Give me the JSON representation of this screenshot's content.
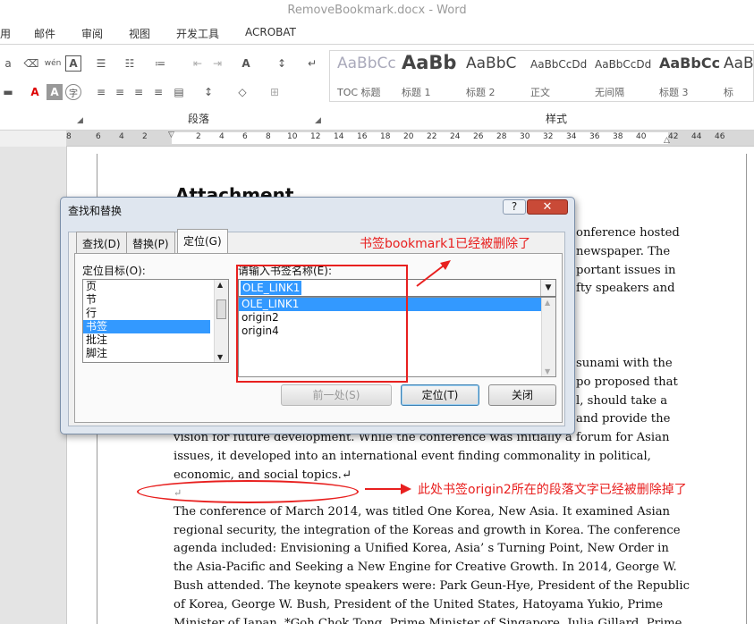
{
  "window": {
    "title": "RemoveBookmark.docx - Word"
  },
  "menu": {
    "items": [
      "用",
      "邮件",
      "审阅",
      "视图",
      "开发工具",
      "ACROBAT"
    ]
  },
  "ribbon": {
    "styles": [
      {
        "sample": "AaBbCc",
        "name": "TOC 标题"
      },
      {
        "sample": "AaBb",
        "name": "标题 1"
      },
      {
        "sample": "AaBbC",
        "name": "标题 2"
      },
      {
        "sample": "AaBbCcDd",
        "name": "正文"
      },
      {
        "sample": "AaBbCcDd",
        "name": "无间隔"
      },
      {
        "sample": "AaBbCc",
        "name": "标题 3"
      },
      {
        "sample": "AaBl",
        "name": "标"
      }
    ],
    "group_paragraph": "段落",
    "group_styles": "样式"
  },
  "ruler": {
    "numbers": [
      "8",
      "6",
      "4",
      "2",
      "2",
      "4",
      "6",
      "8",
      "10",
      "12",
      "14",
      "16",
      "18",
      "20",
      "22",
      "24",
      "26",
      "28",
      "30",
      "32",
      "34",
      "36",
      "38",
      "40",
      "42",
      "44",
      "46"
    ]
  },
  "document": {
    "heading": "Attachment",
    "right_fragments": [
      "onference hosted",
      "newspaper. The",
      "portant issues in",
      "fty speakers and"
    ],
    "right_fragments2": [
      "sunami with the",
      "po proposed that",
      "l, should take a",
      "and provide the"
    ],
    "lines_a": [
      "vision for future development. While the conference was initially a forum for Asian",
      "issues, it developed into an international event finding commonality in political,",
      "economic, and social topics.↵"
    ],
    "empty_para": "↵",
    "lines_b": [
      "The conference of March 2014, was titled One Korea, New Asia. It examined Asian",
      "regional security, the integration of the Koreas and growth in Korea. The conference",
      "agenda included: Envisioning a Unified Korea, Asia’ s Turning Point, New Order in",
      "the Asia-Pacific and Seeking a New Engine for Creative Growth. In 2014, George W.",
      "Bush attended. The keynote speakers were: Park Geun-Hye, President of the Republic",
      "of Korea, George W. Bush, President of the United States, Hatoyama Yukio, Prime",
      "Minister of Japan, *Goh Chok Tong, Prime Minister of Singapore, Julia Gillard, Prime"
    ]
  },
  "dialog": {
    "title": "查找和替换",
    "help": "?",
    "close": "✕",
    "tabs": [
      "查找(D)",
      "替换(P)",
      "定位(G)"
    ],
    "target_label": "定位目标(O):",
    "targets": [
      "页",
      "节",
      "行",
      "书签",
      "批注",
      "脚注"
    ],
    "selected_target": "书签",
    "name_label": "请输入书签名称(E):",
    "name_value": "OLE_LINK1",
    "bookmarks": [
      "OLE_LINK1",
      "origin2",
      "origin4"
    ],
    "selected_bookmark": "OLE_LINK1",
    "btn_prev": "前一处(S)",
    "btn_goto": "定位(T)",
    "btn_close": "关闭"
  },
  "annotations": {
    "note1": "书签bookmark1已经被删除了",
    "note2": "此处书签origin2所在的段落文字已经被删除掉了",
    "accent": "#e8201f"
  }
}
